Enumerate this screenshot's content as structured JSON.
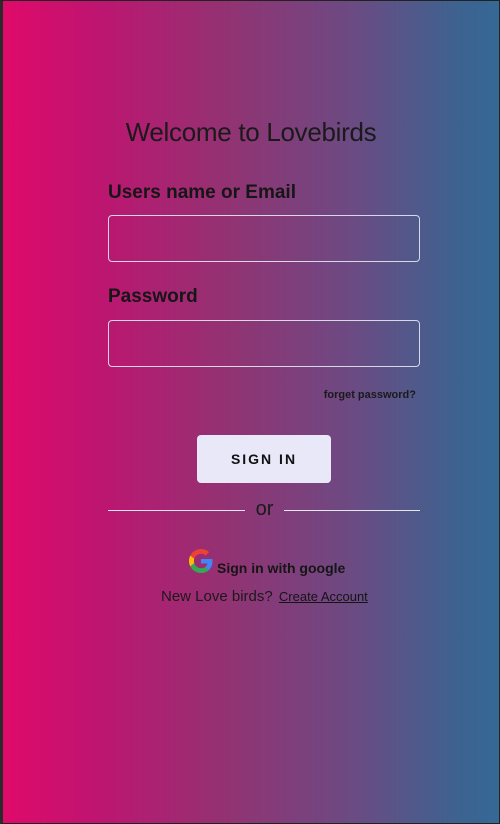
{
  "login": {
    "title": "Welcome to Lovebirds",
    "username_label": "Users name or Email",
    "username_value": "",
    "password_label": "Password",
    "password_value": "",
    "forgot_link": "forget password?",
    "signin_button": "SIGN IN",
    "divider_text": "or",
    "google_button": "Sign in with google",
    "google_icon": "google-logo-icon",
    "new_user_prompt": "New Love birds?",
    "create_account_link": "Create Account"
  },
  "colors": {
    "gradient_left": "#e00a6a",
    "gradient_right": "#356896",
    "button_bg": "#e8e8f8"
  }
}
